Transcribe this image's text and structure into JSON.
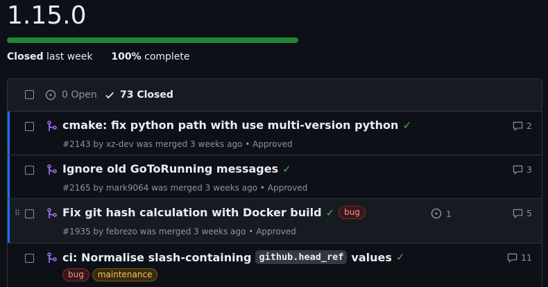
{
  "milestone": {
    "title": "1.15.0",
    "progress_fraction": 1.0,
    "closed_label": "Closed",
    "closed_when": "last week",
    "percent": "100%",
    "percent_suffix": "complete"
  },
  "list": {
    "open_count_label": "0 Open",
    "closed_count_label": "73 Closed",
    "rows": [
      {
        "title": "cmake: fix python path with use multi-version python",
        "meta": "#2143 by xz-dev was merged 3 weeks ago • Approved",
        "comments": "2"
      },
      {
        "title": "Ignore old GoToRunning messages",
        "meta": "#2165 by mark9064 was merged 3 weeks ago • Approved",
        "comments": "3"
      },
      {
        "title": "Fix git hash calculation with Docker build",
        "label": "bug",
        "meta": "#1935 by febrezo was merged 3 weeks ago • Approved",
        "linked": "1",
        "comments": "5"
      },
      {
        "title_prefix": "ci: Normalise slash-containing",
        "title_code": "github.head_ref",
        "title_suffix": "values",
        "labels": [
          "bug",
          "maintenance"
        ],
        "comments": "11"
      }
    ]
  },
  "colors": {
    "accent": "#1f6feb",
    "success": "#3fb950",
    "merged": "#a371f7",
    "progress": "#238636"
  },
  "icons": {
    "open": "issue-opened-icon",
    "closed": "check-icon",
    "merged": "git-merge-icon",
    "comment": "comment-icon",
    "drag": "grabber-icon"
  }
}
